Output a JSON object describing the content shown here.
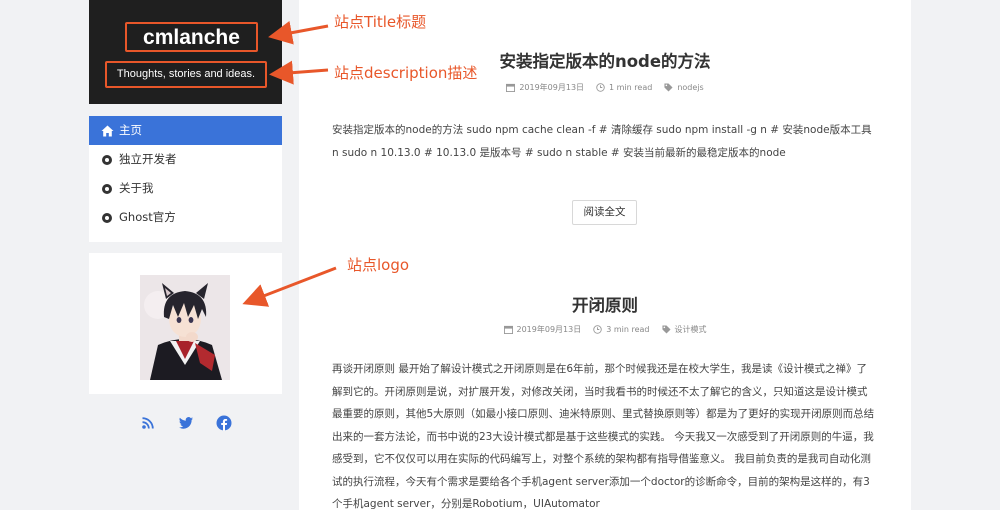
{
  "site": {
    "title": "cmlanche",
    "description": "Thoughts, stories and ideas."
  },
  "nav": {
    "items": [
      {
        "label": "主页",
        "icon": "home-icon",
        "active": true
      },
      {
        "label": "独立开发者",
        "icon": "dot-icon",
        "active": false
      },
      {
        "label": "关于我",
        "icon": "dot-icon",
        "active": false
      },
      {
        "label": "Ghost官方",
        "icon": "dot-icon",
        "active": false
      }
    ]
  },
  "social": [
    "rss-icon",
    "twitter-icon",
    "facebook-icon"
  ],
  "posts": [
    {
      "title": "安装指定版本的node的方法",
      "date": "2019年09月13日",
      "read": "1 min read",
      "tag": "nodejs",
      "excerpt": "安装指定版本的node的方法 sudo npm cache clean -f # 清除缓存 sudo npm install -g n # 安装node版本工具n sudo n 10.13.0 # 10.13.0 是版本号 # sudo n stable # 安装当前最新的最稳定版本的node",
      "read_more": "阅读全文"
    },
    {
      "title": "开闭原则",
      "date": "2019年09月13日",
      "read": "3 min read",
      "tag": "设计模式",
      "excerpt": "再谈开闭原则 最开始了解设计模式之开闭原则是在6年前，那个时候我还是在校大学生，我是读《设计模式之禅》了解到它的。开闭原则是说，对扩展开发，对修改关闭，当时我看书的时候还不太了解它的含义，只知道这是设计模式最重要的原则，其他5大原则（如最小接口原则、迪米特原则、里式替换原则等）都是为了更好的实现开闭原则而总结出来的一套方法论，而书中说的23大设计模式都是基于这些模式的实践。 今天我又一次感受到了开闭原则的牛逼，我感受到，它不仅仅可以用在实际的代码编写上，对整个系统的架构都有指导借鉴意义。 我目前负责的是我司自动化测试的执行流程，今天有个需求是要给各个手机agent server添加一个doctor的诊断命令，目前的架构是这样的，有3个手机agent server，分别是Robotium，UIAutomator"
    }
  ],
  "annotations": {
    "title": "站点Title标题",
    "description": "站点description描述",
    "logo": "站点logo"
  },
  "colors": {
    "accent": "#e8572a",
    "nav_active": "#3a73d9",
    "brand_bg": "#1f1f1f",
    "social": "#3a73d9"
  }
}
